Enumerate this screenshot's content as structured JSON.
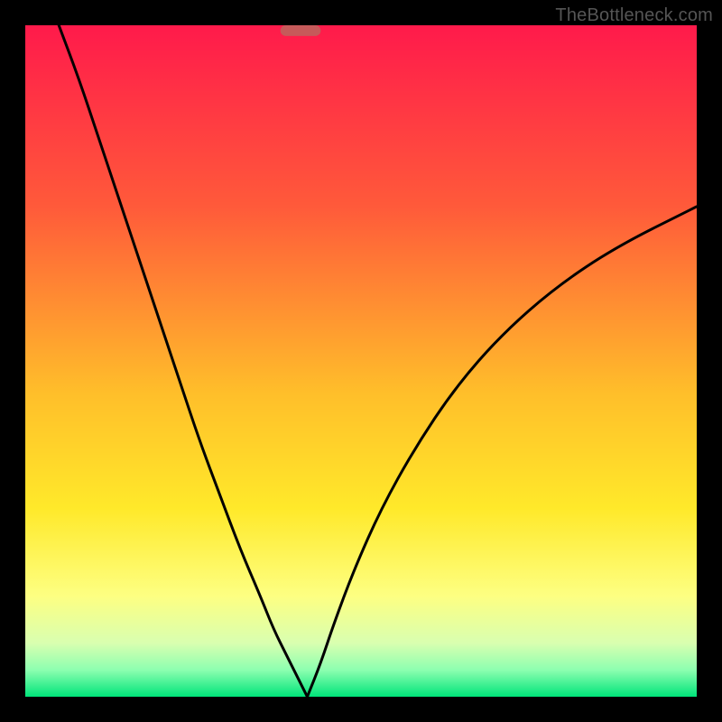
{
  "watermark": "TheBottleneck.com",
  "chart_data": {
    "type": "line",
    "title": "",
    "xlabel": "",
    "ylabel": "",
    "xlim": [
      0,
      100
    ],
    "ylim": [
      0,
      100
    ],
    "grid": false,
    "legend": false,
    "gradient_stops": [
      {
        "offset": 0,
        "color": "#ff1a4b"
      },
      {
        "offset": 27,
        "color": "#ff5a3a"
      },
      {
        "offset": 55,
        "color": "#ffbf2a"
      },
      {
        "offset": 72,
        "color": "#ffe92a"
      },
      {
        "offset": 85,
        "color": "#fdff82"
      },
      {
        "offset": 92,
        "color": "#d9ffb0"
      },
      {
        "offset": 96,
        "color": "#8dffb0"
      },
      {
        "offset": 100,
        "color": "#00e47a"
      }
    ],
    "marker": {
      "x": 41,
      "y": 99.2,
      "width": 6,
      "height": 1.6,
      "color": "#c65a5a"
    },
    "series": [
      {
        "name": "left-branch",
        "x": [
          5,
          8,
          11,
          14,
          17,
          20,
          23,
          26,
          29,
          32,
          35,
          37,
          39,
          40,
          41,
          42
        ],
        "y": [
          100,
          92,
          83,
          74,
          65,
          56,
          47,
          38,
          30,
          22,
          15,
          10,
          6,
          4,
          2,
          0
        ]
      },
      {
        "name": "right-branch",
        "x": [
          42,
          44,
          46,
          49,
          53,
          58,
          64,
          71,
          79,
          88,
          100
        ],
        "y": [
          0,
          5,
          11,
          19,
          28,
          37,
          46,
          54,
          61,
          67,
          73
        ]
      }
    ]
  }
}
